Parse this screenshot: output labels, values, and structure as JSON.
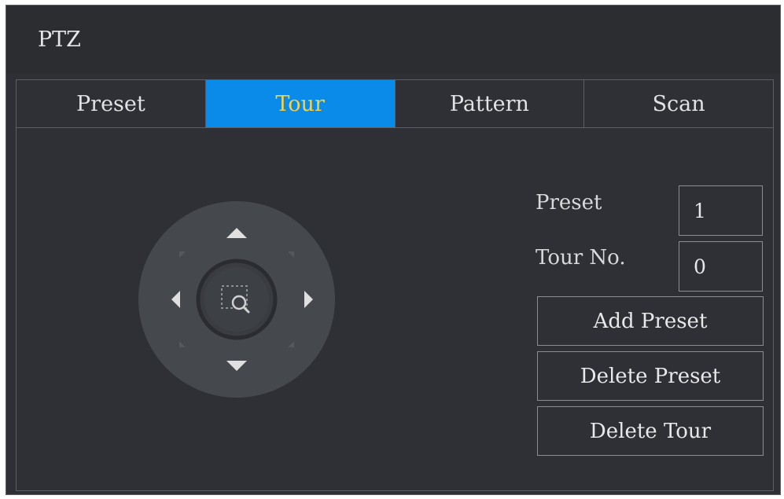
{
  "dialog": {
    "title": "PTZ"
  },
  "tabs": [
    {
      "label": "Preset",
      "active": false
    },
    {
      "label": "Tour",
      "active": true
    },
    {
      "label": "Pattern",
      "active": false
    },
    {
      "label": "Scan",
      "active": false
    }
  ],
  "fields": {
    "preset": {
      "label": "Preset",
      "value": "1"
    },
    "tour_no": {
      "label": "Tour No.",
      "value": "0"
    }
  },
  "buttons": {
    "add_preset": "Add Preset",
    "delete_preset": "Delete Preset",
    "delete_tour": "Delete Tour"
  },
  "joystick": {
    "icons": [
      "up-arrow-icon",
      "down-arrow-icon",
      "left-arrow-icon",
      "right-arrow-icon",
      "zoom-area-icon"
    ]
  },
  "colors": {
    "background": "#2e3035",
    "active_tab": "#0a8be9",
    "active_tab_text": "#f3d24a",
    "border": "#5c5f64"
  }
}
